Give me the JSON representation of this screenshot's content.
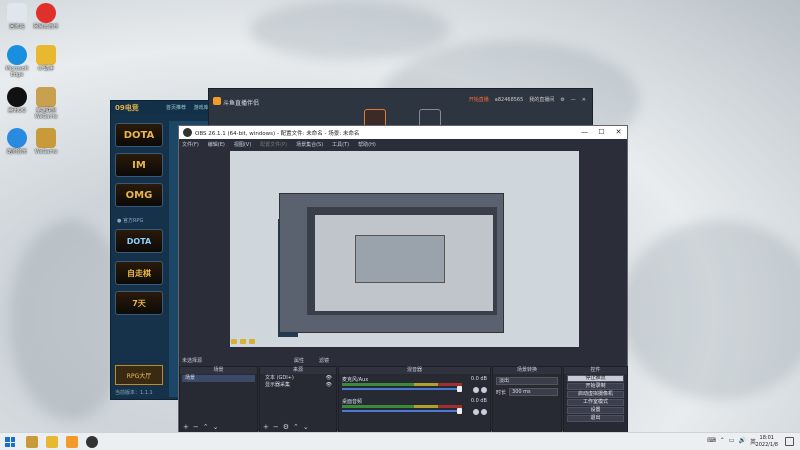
{
  "desktop": {
    "icons": [
      {
        "label": "回收站",
        "color": "#dfe6ee"
      },
      {
        "label": "网易云音乐",
        "color": "#e0302a"
      },
      {
        "label": "Microsoft Edge",
        "color": "#1a8fe0"
      },
      {
        "label": "CF助手",
        "color": "#e8b830"
      },
      {
        "label": "腾讯QQ",
        "color": "#111111"
      },
      {
        "label": "英雄联盟WeGame",
        "color": "#c8a050"
      },
      {
        "label": "酷狗音乐",
        "color": "#2a8ae0"
      },
      {
        "label": "WeGame",
        "color": "#c89a3a"
      }
    ]
  },
  "launcher": {
    "title": "09电竞",
    "nav": [
      "首页推荐",
      "游戏库"
    ],
    "games": [
      "DOTA",
      "IM",
      "OMG",
      "DOTA",
      "自走棋",
      "7天"
    ],
    "section_label": "● 官方RPG",
    "rpg_button": "RPG大厅",
    "version": "当前版本：1.1.1"
  },
  "douyu": {
    "title": "斗鱼直播伴侣",
    "live_button": "开始直播",
    "user": "a82468565",
    "my_live": "我的直播间"
  },
  "obs": {
    "title": "OBS 26.1.1 (64-bit, windows) - 配置文件: 未命名 - 场景: 未命名",
    "menu": [
      "文件(F)",
      "编辑(E)",
      "视图(V)",
      "配置文件(P)",
      "场景集合(S)",
      "工具(T)",
      "帮助(H)"
    ],
    "scene_label": "未选择源",
    "filter_label": "属性",
    "props_label": "滤镜",
    "docks": {
      "scenes": {
        "header": "场景",
        "items": [
          "场景"
        ]
      },
      "sources": {
        "header": "来源",
        "items": [
          "文本 (GDI+)",
          "显示器采集"
        ]
      },
      "mixer": {
        "header": "混音器",
        "channels": [
          {
            "name": "麦克风/Aux",
            "db": "0.0 dB"
          },
          {
            "name": "桌面音频",
            "db": "0.0 dB"
          }
        ]
      },
      "transitions": {
        "header": "场景转换",
        "type": "淡出",
        "duration_label": "时长",
        "duration": "300 ms"
      },
      "controls": {
        "header": "控件",
        "buttons": [
          "停止推流",
          "开始录制",
          "启动虚拟摄像机",
          "工作室模式",
          "设置",
          "退出"
        ]
      }
    }
  },
  "taskbar": {
    "apps": [
      {
        "name": "WeGame",
        "color": "#c89a3a"
      },
      {
        "name": "09电竞",
        "color": "#e8b830"
      },
      {
        "name": "斗鱼直播伴侣",
        "color": "#f29a2a"
      },
      {
        "name": "OBS",
        "color": "#333333"
      }
    ],
    "tray_text": "英",
    "time": "18:01",
    "date": "2022/1/8"
  },
  "colors": {
    "taskbar_bg": "#eceff2",
    "obs_bg": "#2b2e38",
    "accent": "#4a7ad0"
  }
}
